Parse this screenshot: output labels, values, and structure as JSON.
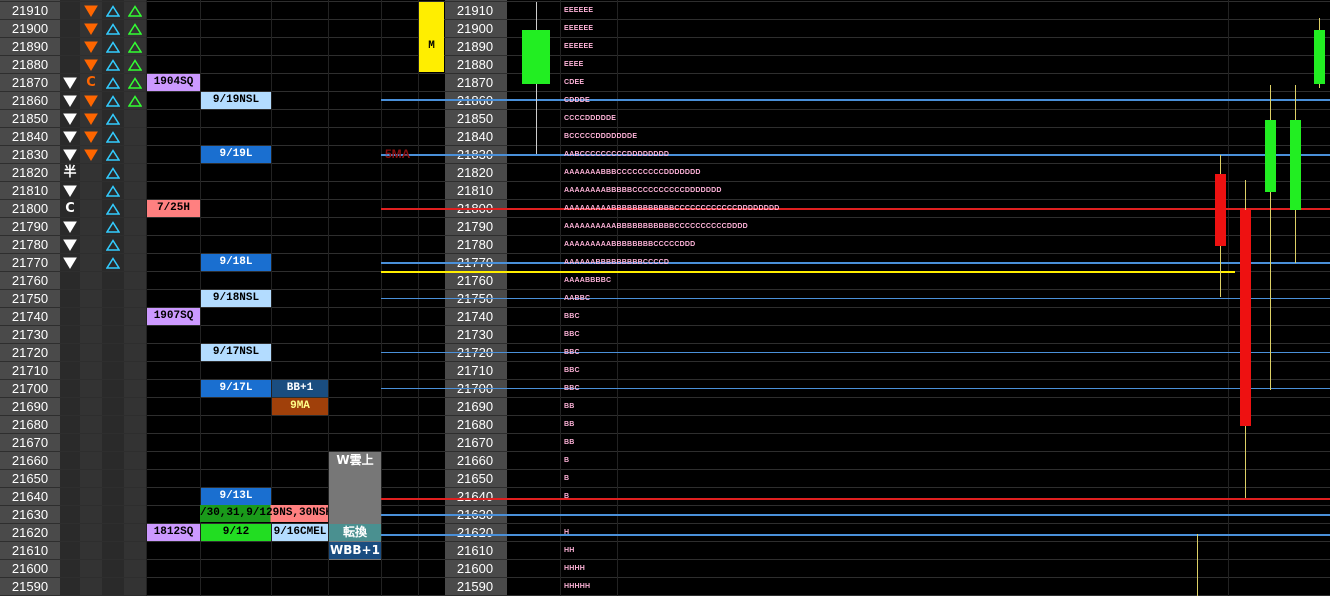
{
  "prices": [
    "21910",
    "21900",
    "21890",
    "21880",
    "21870",
    "21860",
    "21850",
    "21840",
    "21830",
    "21820",
    "21810",
    "21800",
    "21790",
    "21780",
    "21770",
    "21760",
    "21750",
    "21740",
    "21730",
    "21720",
    "21710",
    "21700",
    "21690",
    "21680",
    "21670",
    "21660",
    "21650",
    "21640",
    "21630",
    "21620",
    "21610",
    "21600",
    "21590"
  ],
  "colors": {
    "background": "#000000",
    "price_col": "#4a4a4a",
    "down_arrow": "#ff6600",
    "up_arrow_cyan": "#33ccff",
    "up_arrow_green": "#33ff33",
    "line_blue": "#4a90d9",
    "line_red": "#e02020",
    "line_yellow": "#ffee00",
    "candle_green": "#22ee22",
    "candle_red": "#ee1111",
    "tpo_pink": "#ffb3d9"
  },
  "col1_symbols": [
    {
      "row": 4,
      "type": "white-down"
    },
    {
      "row": 5,
      "type": "white-down"
    },
    {
      "row": 6,
      "type": "white-down"
    },
    {
      "row": 7,
      "type": "white-down"
    },
    {
      "row": 8,
      "type": "white-down"
    },
    {
      "row": 9,
      "type": "text",
      "text": "半"
    },
    {
      "row": 10,
      "type": "white-down"
    },
    {
      "row": 11,
      "type": "text",
      "text": "C"
    },
    {
      "row": 12,
      "type": "white-down"
    },
    {
      "row": 13,
      "type": "white-down"
    },
    {
      "row": 14,
      "type": "white-down"
    }
  ],
  "col2_symbols": [
    {
      "row": 0,
      "type": "orange-down"
    },
    {
      "row": 1,
      "type": "orange-down"
    },
    {
      "row": 2,
      "type": "orange-down"
    },
    {
      "row": 3,
      "type": "orange-down"
    },
    {
      "row": 4,
      "type": "orange-text",
      "text": "C"
    },
    {
      "row": 5,
      "type": "orange-down"
    },
    {
      "row": 6,
      "type": "orange-down"
    },
    {
      "row": 7,
      "type": "orange-down"
    },
    {
      "row": 8,
      "type": "orange-down"
    }
  ],
  "col3_rows": [
    0,
    1,
    2,
    3,
    4,
    5,
    6,
    7,
    8,
    9,
    10,
    11,
    12,
    13,
    14
  ],
  "col4_rows": [
    0,
    1,
    2,
    3,
    4,
    5
  ],
  "labels": [
    {
      "id": "1904sq",
      "text": "1904SQ",
      "row": 4,
      "col": "a",
      "bg": "#cc99ff",
      "fg": "#000000"
    },
    {
      "id": "725h",
      "text": "7/25H",
      "row": 11,
      "col": "a",
      "bg": "#ff8080",
      "fg": "#000000"
    },
    {
      "id": "1907sq",
      "text": "1907SQ",
      "row": 17,
      "col": "a",
      "bg": "#cc99ff",
      "fg": "#000000"
    },
    {
      "id": "1812sq",
      "text": "1812SQ",
      "row": 29,
      "col": "a",
      "bg": "#cc99ff",
      "fg": "#000000"
    },
    {
      "id": "919nsl",
      "text": "9/19NSL",
      "row": 5,
      "col": "b",
      "bg": "#b3dcff",
      "fg": "#000000"
    },
    {
      "id": "919l",
      "text": "9/19L",
      "row": 8,
      "col": "b",
      "bg": "#1a6fd0",
      "fg": "#ffffff"
    },
    {
      "id": "918l",
      "text": "9/18L",
      "row": 14,
      "col": "b",
      "bg": "#1a6fd0",
      "fg": "#ffffff"
    },
    {
      "id": "918nsl",
      "text": "9/18NSL",
      "row": 16,
      "col": "b",
      "bg": "#b3dcff",
      "fg": "#000000"
    },
    {
      "id": "917nsl",
      "text": "9/17NSL",
      "row": 19,
      "col": "b",
      "bg": "#b3dcff",
      "fg": "#000000"
    },
    {
      "id": "917l",
      "text": "9/17L",
      "row": 21,
      "col": "b",
      "bg": "#1a6fd0",
      "fg": "#ffffff"
    },
    {
      "id": "913l",
      "text": "9/13L",
      "row": 27,
      "col": "b",
      "bg": "#1a6fd0",
      "fg": "#ffffff"
    },
    {
      "id": "912",
      "text": "9/12",
      "row": 29,
      "col": "b",
      "bg": "#22dd22",
      "fg": "#000000"
    },
    {
      "id": "bb1",
      "text": "BB+1",
      "row": 21,
      "col": "c",
      "bg": "#1a4d80",
      "fg": "#ffffff"
    },
    {
      "id": "9ma",
      "text": "9MA",
      "row": 22,
      "col": "c",
      "bg": "#a0400a",
      "fg": "#ffff88"
    },
    {
      "id": "916cmel",
      "text": "9/16CMEL",
      "row": 29,
      "col": "c",
      "bg": "#b3dcff",
      "fg": "#000000"
    },
    {
      "id": "wcloud",
      "text": "W雲上",
      "row": 25,
      "col": "d",
      "bg": "#777777",
      "fg": "#ffffff"
    },
    {
      "id": "tenkan",
      "text": "転換",
      "row": 29,
      "col": "d",
      "bg": "#4a9090",
      "fg": "#ffffff"
    },
    {
      "id": "wbb1",
      "text": "WBB+1",
      "row": 30,
      "col": "d",
      "bg": "#1a4d80",
      "fg": "#ffffff"
    },
    {
      "id": "m",
      "text": "M",
      "row": 2,
      "col": "e",
      "bg": "#ffee00",
      "fg": "#000000"
    }
  ],
  "wide_label": {
    "text": "/30,31,9/129NS,30NSH"
  },
  "sma_label": {
    "text": "5MA"
  },
  "tpo": [
    {
      "row": 0,
      "text": "EEEEEE"
    },
    {
      "row": 1,
      "text": "EEEEEE"
    },
    {
      "row": 2,
      "text": "EEEEEE"
    },
    {
      "row": 3,
      "text": "EEEE"
    },
    {
      "row": 4,
      "text": "CDEE"
    },
    {
      "row": 5,
      "text": "CDDDE"
    },
    {
      "row": 6,
      "text": "CCCCDDDDDE"
    },
    {
      "row": 7,
      "text": "BCCCCCDDDDDDDE"
    },
    {
      "row": 8,
      "text": "AABCCCCCCCCCDDDDDDDD"
    },
    {
      "row": 9,
      "text": "AAAAAAABBBCCCCCCCCCDDDDDDD"
    },
    {
      "row": 10,
      "text": "AAAAAAAABBBBBCCCCCCCCCCDDDDDDD"
    },
    {
      "row": 11,
      "text": "AAAAAAAAABBBBBBBBBBBBCCCCCCCCCCCCDDDDDDDD"
    },
    {
      "row": 12,
      "text": "AAAAAAAAAABBBBBBBBBBBCCCCCCCCCCDDDD"
    },
    {
      "row": 13,
      "text": "AAAAAAAAABBBBBBBBCCCCCDDD"
    },
    {
      "row": 14,
      "text": "AAAAAABBBBBBBBBCCCCD"
    },
    {
      "row": 15,
      "text": "AAAABBBBC"
    },
    {
      "row": 16,
      "text": "AABBC"
    },
    {
      "row": 17,
      "text": "BBC"
    },
    {
      "row": 18,
      "text": "BBC"
    },
    {
      "row": 19,
      "text": "BBC"
    },
    {
      "row": 20,
      "text": "BBC"
    },
    {
      "row": 21,
      "text": "BBC"
    },
    {
      "row": 22,
      "text": "BB"
    },
    {
      "row": 23,
      "text": "BB"
    },
    {
      "row": 24,
      "text": "BB"
    },
    {
      "row": 25,
      "text": "B"
    },
    {
      "row": 26,
      "text": "B"
    },
    {
      "row": 27,
      "text": "B"
    },
    {
      "row": 29,
      "text": "H"
    },
    {
      "row": 30,
      "text": "HH"
    },
    {
      "row": 31,
      "text": "HHHH"
    },
    {
      "row": 32,
      "text": "HHHHH"
    }
  ]
}
